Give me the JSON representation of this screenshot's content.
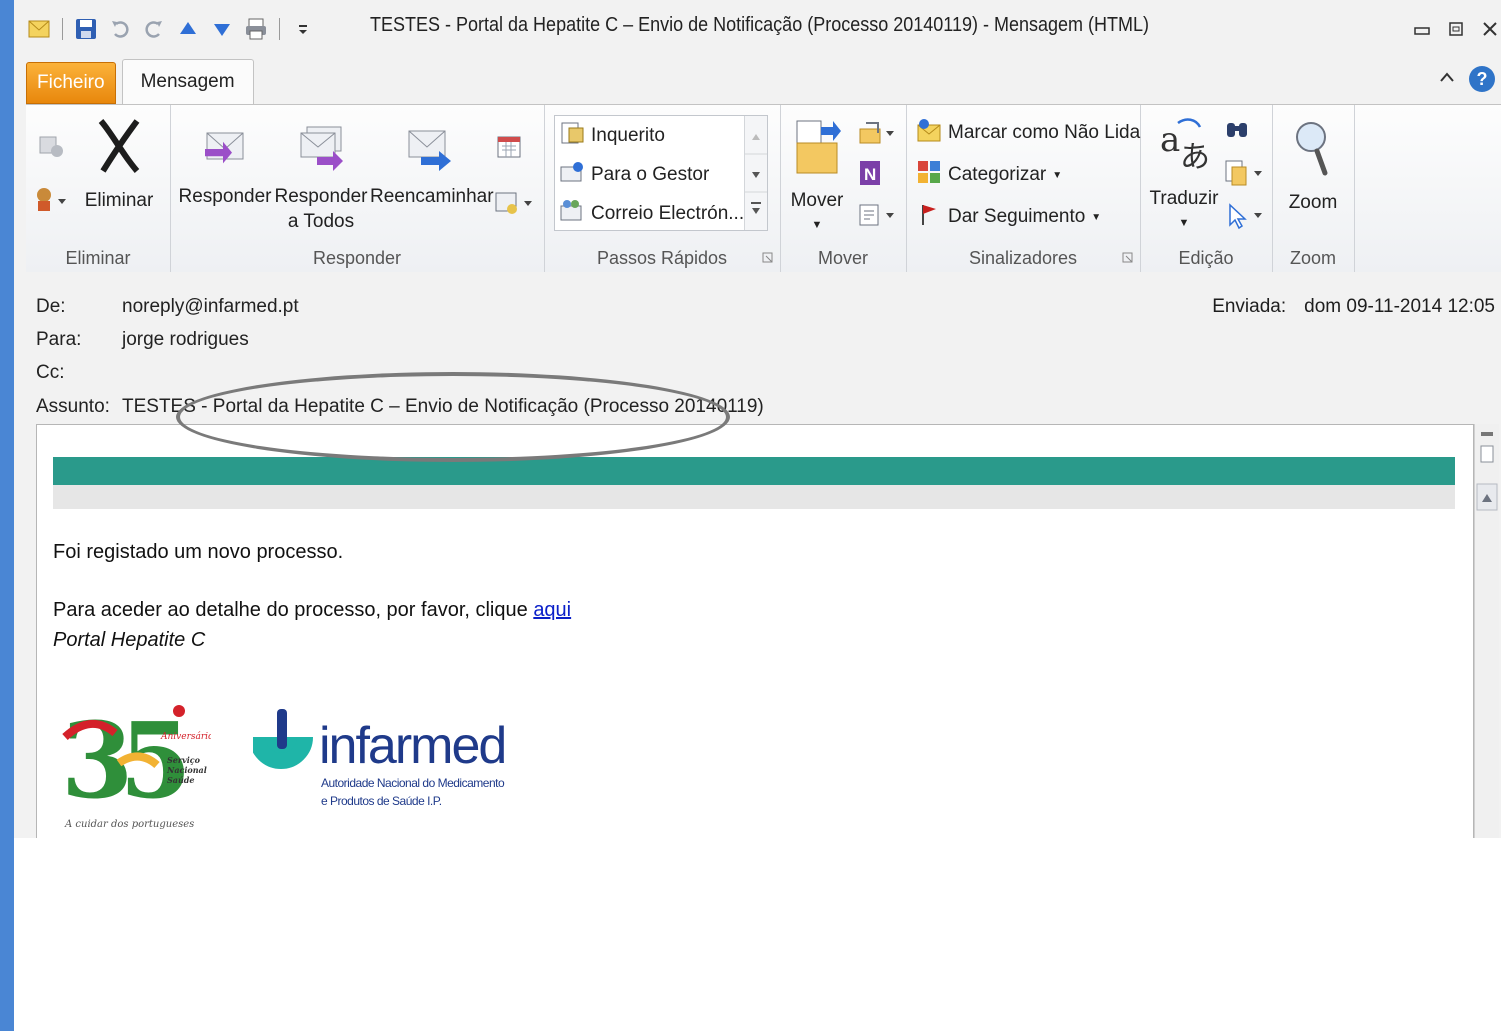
{
  "window": {
    "title": "TESTES - Portal da Hepatite C – Envio de Notificação (Processo 20140119)  -  Mensagem (HTML)"
  },
  "tabs": {
    "file": "Ficheiro",
    "message": "Mensagem"
  },
  "ribbon": {
    "eliminar_group": {
      "label": "Eliminar",
      "delete_button": "Eliminar"
    },
    "responder_group": {
      "label": "Responder",
      "reply": "Responder",
      "reply_all_line1": "Responder",
      "reply_all_line2": "a Todos",
      "forward": "Reencaminhar"
    },
    "quick_steps_group": {
      "label": "Passos Rápidos",
      "items": [
        "Inquerito",
        "Para o Gestor",
        "Correio Electrón..."
      ]
    },
    "mover_group": {
      "label": "Mover",
      "move_button": "Mover"
    },
    "tags_group": {
      "label": "Sinalizadores",
      "mark_unread": "Marcar como Não Lida",
      "categorize": "Categorizar",
      "follow_up": "Dar Seguimento"
    },
    "editing_group": {
      "label": "Edição",
      "translate": "Traduzir"
    },
    "zoom_group": {
      "label": "Zoom",
      "zoom_button": "Zoom"
    }
  },
  "header": {
    "from_label": "De:",
    "from_value": "noreply@infarmed.pt",
    "to_label": "Para:",
    "to_value": "jorge rodrigues",
    "cc_label": "Cc:",
    "subject_label": "Assunto:",
    "subject_value": "TESTES - Portal da Hepatite C – Envio de Notificação (Processo 20140119)",
    "sent_label": "Enviada:",
    "sent_value": "dom 09-11-2014 12:05"
  },
  "body": {
    "line1": "Foi registado um novo processo.",
    "line2_prefix": "Para aceder ao detalhe do processo, por favor, clique ",
    "line2_link": "aqui",
    "signature": "Portal Hepatite C",
    "logo35_number": "35",
    "logo35_aniversario": "Aniversário",
    "logo35_sns1": "Serviço",
    "logo35_sns2": "Nacional",
    "logo35_sns3": "Saúde",
    "logo35_tagline": "A cuidar dos portugueses",
    "infarmed_name": "infarmed",
    "infarmed_sub1": "Autoridade Nacional do Medicamento",
    "infarmed_sub2": "e Produtos de Saúde I.P."
  },
  "colors": {
    "accent_bar": "#4a86d4",
    "file_tab": "#f7a11a",
    "teal_bar": "#2a9a8b",
    "link": "#0b20c9",
    "annotation_oval": "#7a7a7a"
  }
}
